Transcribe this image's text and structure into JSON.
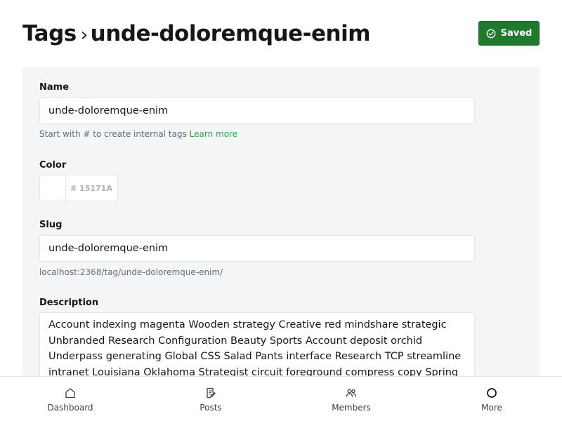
{
  "header": {
    "breadcrumb_parent": "Tags",
    "separator": "›",
    "title": "unde-doloremque-enim",
    "saved_label": "Saved"
  },
  "form": {
    "name": {
      "label": "Name",
      "value": "unde-doloremque-enim",
      "hint": "Start with # to create internal tags",
      "hint_link": "Learn more"
    },
    "color": {
      "label": "Color",
      "value": "# 15171A"
    },
    "slug": {
      "label": "Slug",
      "value": "unde-doloremque-enim",
      "url": "localhost:2368/tag/unde-doloremque-enim/"
    },
    "description": {
      "label": "Description",
      "value": "Account indexing magenta Wooden strategy Creative red mindshare strategic Unbranded Research Configuration Beauty Sports Account deposit orchid Underpass generating Global CSS Salad Pants interface Research TCP streamline intranet Louisiana Oklahoma Strategist circuit foreground compress copy Spring Checking Health invoice Rupee"
    }
  },
  "tabbar": {
    "items": [
      {
        "label": "Dashboard",
        "icon": "home-icon"
      },
      {
        "label": "Posts",
        "icon": "posts-icon"
      },
      {
        "label": "Members",
        "icon": "members-icon"
      },
      {
        "label": "More",
        "icon": "more-icon"
      }
    ]
  },
  "colors": {
    "accent_green": "#30a346",
    "saved_button": "#1f7a2e",
    "panel_bg": "#f4f5f6"
  }
}
